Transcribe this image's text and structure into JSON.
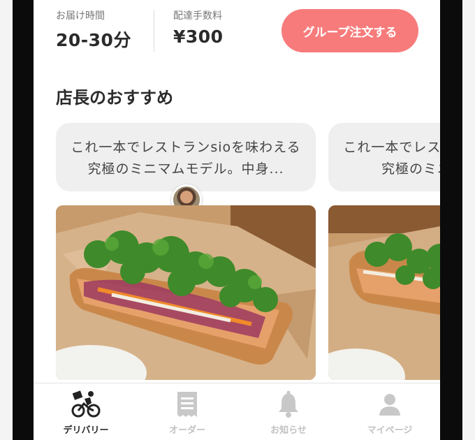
{
  "info": {
    "delivery_time_label": "お届け時間",
    "delivery_time_value": "20-30分",
    "fee_label": "配達手数料",
    "fee_value": "¥300",
    "group_order_label": "グループ注文する"
  },
  "section": {
    "title": "店長のおすすめ"
  },
  "cards": [
    {
      "text": "これ一本でレストランsioを味わえる究極のミニマムモデル。中身..."
    },
    {
      "text": "これ一本でレストランsioを味わえる究極のミニマムモデル。"
    }
  ],
  "tabbar": {
    "items": [
      {
        "label": "デリバリー",
        "icon": "bicycle-delivery-icon",
        "active": true
      },
      {
        "label": "オーダー",
        "icon": "receipt-icon",
        "active": false
      },
      {
        "label": "お知らせ",
        "icon": "bell-icon",
        "active": false
      },
      {
        "label": "マイページ",
        "icon": "person-icon",
        "active": false
      }
    ]
  },
  "colors": {
    "accent": "#f77b7b",
    "text": "#2b2b2b",
    "muted": "#c2c2c2",
    "bubble": "#efefef"
  }
}
